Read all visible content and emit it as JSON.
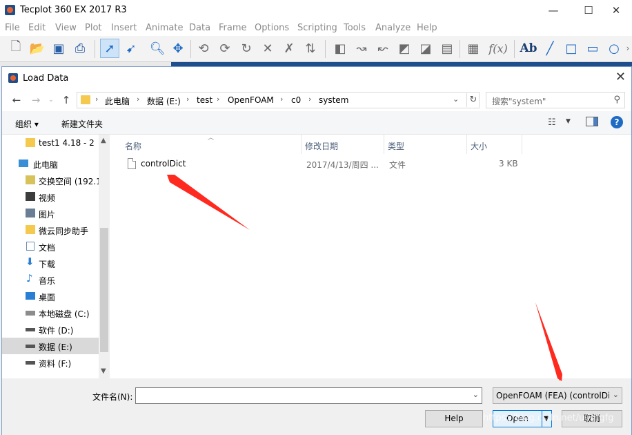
{
  "app": {
    "title": "Tecplot 360 EX 2017 R3",
    "window_controls": {
      "minimize": "—",
      "maximize": "☐",
      "close": "✕"
    },
    "menu": [
      "File",
      "Edit",
      "View",
      "Plot",
      "Insert",
      "Animate",
      "Data",
      "Frame",
      "Options",
      "Scripting",
      "Tools",
      "Analyze",
      "Help"
    ],
    "toolbar_icons": [
      "new-file-icon",
      "open-file-icon",
      "save-icon",
      "print-icon",
      "select-arrow-icon",
      "adjustor-icon",
      "zoom-icon",
      "translate-icon",
      "rotate-x-icon",
      "rotate-y-icon",
      "rotate-z-icon",
      "rotate-free-icon",
      "rollerball-icon",
      "spin-icon",
      "probe-icon",
      "slice-icon",
      "streamtrace-icon",
      "contour-add-icon",
      "contour-remove-icon",
      "zone-icon",
      "data-label-icon",
      "function-icon",
      "text-icon",
      "line-icon",
      "square-icon",
      "rectangle-icon",
      "circle-icon"
    ],
    "toolbar_text": {
      "function": "f(x)",
      "text_tool": "Ab"
    }
  },
  "dialog": {
    "title": "Load Data",
    "close": "✕",
    "address": {
      "crumbs": [
        "此电脑",
        "数据 (E:)",
        "test",
        "OpenFOAM",
        "c0",
        "system"
      ]
    },
    "search": {
      "placeholder": "搜索\"system\""
    },
    "commands": {
      "organize": "组织 ▾",
      "new_folder": "新建文件夹"
    },
    "sidebar": {
      "items": [
        {
          "label": "test1 4.18 - 2",
          "icon": "folder-icon"
        },
        {
          "label": "此电脑",
          "icon": "computer-icon"
        },
        {
          "label": "交换空间 (192.1",
          "icon": "network-drive-icon"
        },
        {
          "label": "视频",
          "icon": "video-icon"
        },
        {
          "label": "图片",
          "icon": "pictures-icon"
        },
        {
          "label": "微云同步助手",
          "icon": "weiyun-icon"
        },
        {
          "label": "文档",
          "icon": "documents-icon"
        },
        {
          "label": "下载",
          "icon": "download-icon"
        },
        {
          "label": "音乐",
          "icon": "music-icon"
        },
        {
          "label": "桌面",
          "icon": "desktop-icon"
        },
        {
          "label": "本地磁盘 (C:)",
          "icon": "drive-icon"
        },
        {
          "label": "软件 (D:)",
          "icon": "drive-icon"
        },
        {
          "label": "数据 (E:)",
          "icon": "drive-icon",
          "selected": true
        },
        {
          "label": "资料 (F:)",
          "icon": "drive-icon"
        }
      ]
    },
    "columns": {
      "name": "名称",
      "date": "修改日期",
      "type": "类型",
      "size": "大小"
    },
    "files": [
      {
        "name": "controlDict",
        "date": "2017/4/13/周四 ...",
        "type": "文件",
        "size": "3 KB"
      }
    ],
    "footer": {
      "filename_label": "文件名(N):",
      "filename_value": "",
      "filetype": "OpenFOAM (FEA) (controlDict)",
      "help": "Help",
      "open": "Open",
      "cancel": "取消"
    }
  },
  "watermark": "https://blog.csdn.net/u0dfgfg",
  "colors": {
    "accent": "#0078d7",
    "annotation_arrow": "#ff2a1f",
    "app_blue": "#1f4e8c"
  }
}
